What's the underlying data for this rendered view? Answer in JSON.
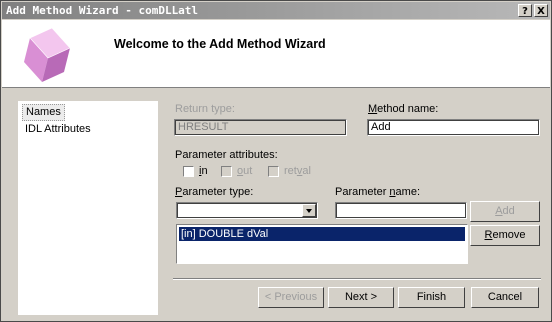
{
  "window": {
    "title": "Add Method Wizard - comDLLatl"
  },
  "titlebar_buttons": {
    "help": "?",
    "close": "X"
  },
  "header": {
    "title": "Welcome to the Add Method Wizard",
    "logo_icon": "wizard-cube-icon"
  },
  "nav": {
    "items": [
      {
        "label": "Names",
        "selected": true
      },
      {
        "label": "IDL Attributes",
        "selected": false
      }
    ]
  },
  "form": {
    "return_type": {
      "label": "Return type:",
      "value": "HRESULT"
    },
    "method_name": {
      "label_prefix": "",
      "label_underline": "M",
      "label_rest": "ethod name:",
      "value": "Add"
    },
    "parameter_attributes": {
      "label": "Parameter attributes:",
      "in": {
        "u": "i",
        "rest": "n"
      },
      "out": {
        "u": "o",
        "rest": "ut"
      },
      "retval": {
        "pre": "ret",
        "u": "v",
        "rest": "al"
      }
    },
    "parameter_type": {
      "label_prefix": "",
      "label_underline": "P",
      "label_rest": "arameter type:",
      "value": ""
    },
    "parameter_name": {
      "label_prefix": "Parameter ",
      "label_underline": "n",
      "label_rest": "ame:",
      "value": ""
    },
    "add_button": {
      "u": "A",
      "rest": "dd"
    },
    "remove_button": {
      "u": "R",
      "rest": "emove"
    },
    "parameters": [
      "[in] DOUBLE dVal"
    ]
  },
  "footer": {
    "previous": "< Previous",
    "next": "Next >",
    "finish": "Finish",
    "cancel": "Cancel"
  }
}
